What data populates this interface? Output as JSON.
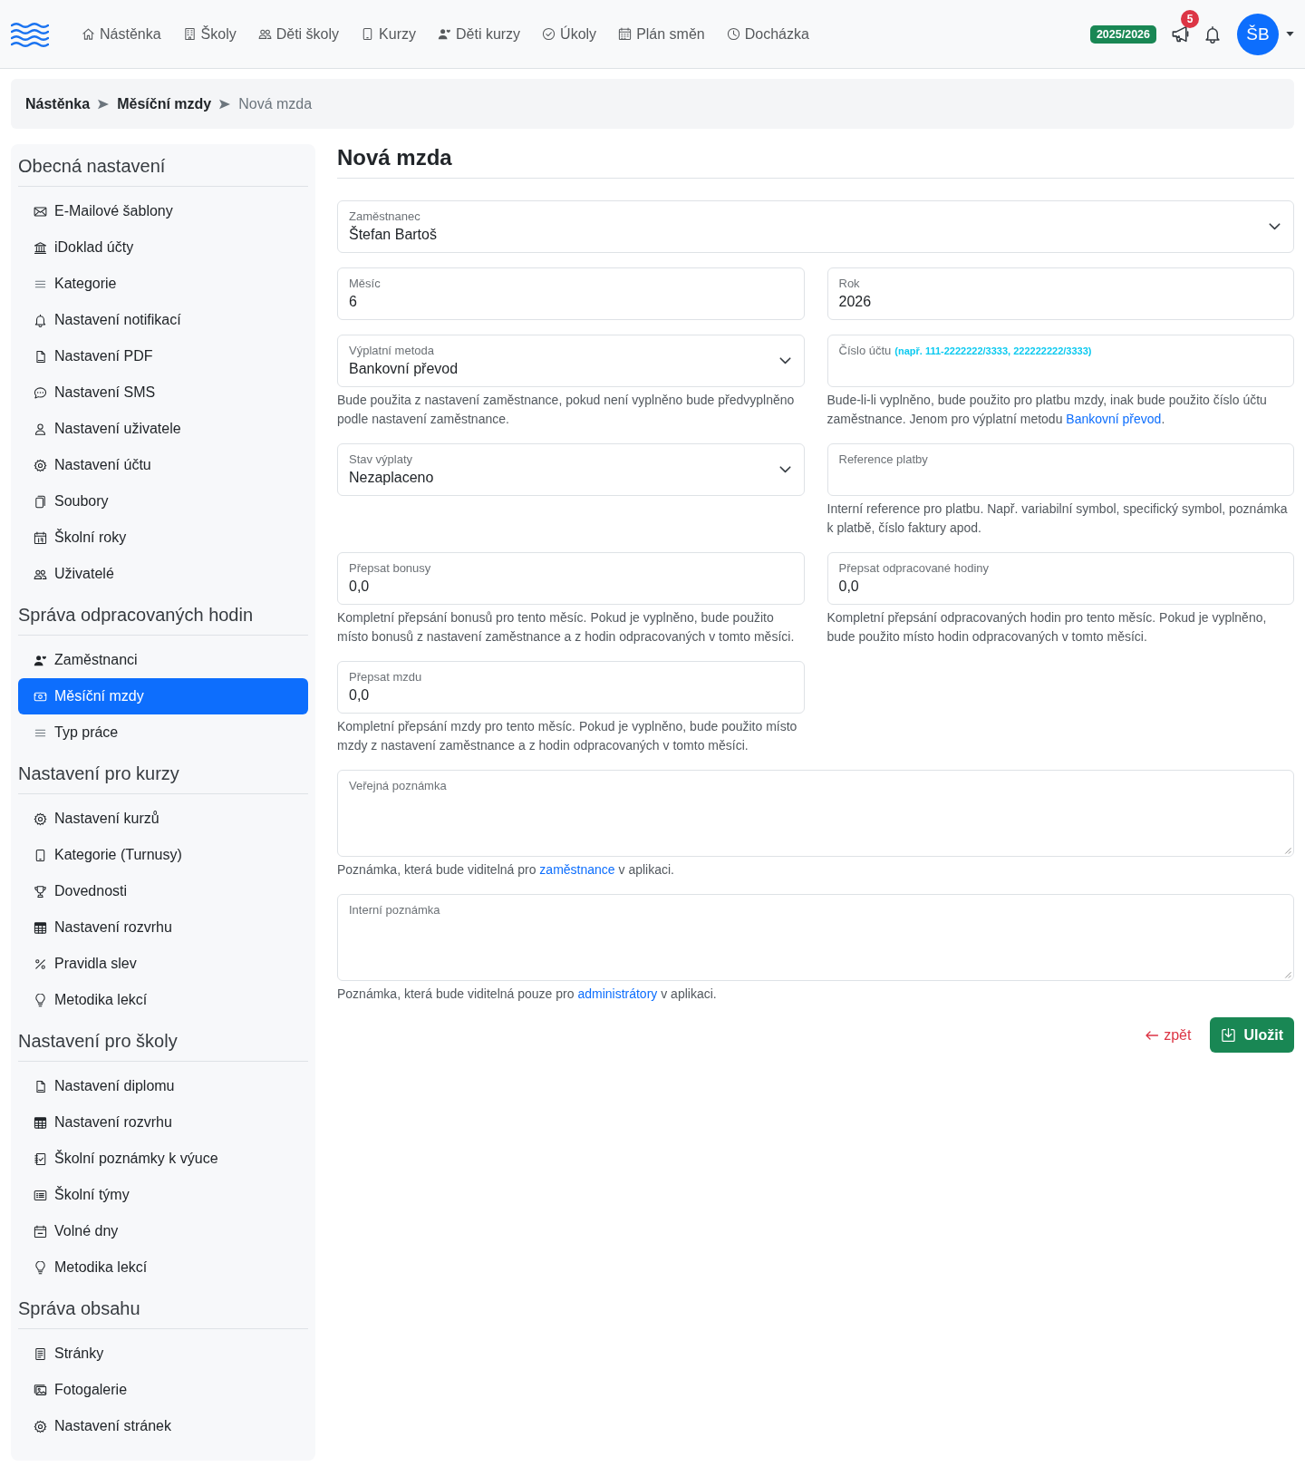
{
  "navbar": {
    "items": [
      "Nástěnka",
      "Školy",
      "Děti školy",
      "Kurzy",
      "Děti kurzy",
      "Úkoly",
      "Plán směn",
      "Docházka"
    ],
    "school_year": "2025/2026",
    "notifications": {
      "count": "5"
    },
    "user": {
      "initials": "ŠB"
    }
  },
  "breadcrumb": [
    {
      "label": "Nástěnka",
      "current": false
    },
    {
      "label": "Měsíční mzdy",
      "current": false
    },
    {
      "label": "Nová mzda",
      "current": true
    }
  ],
  "sidebar": {
    "sections": [
      {
        "title": "Obecná nastavení",
        "items": [
          {
            "label": "E-Mailové šablony",
            "selected": false
          },
          {
            "label": "iDoklad účty",
            "selected": false
          },
          {
            "label": "Kategorie",
            "selected": false
          },
          {
            "label": "Nastavení notifikací",
            "selected": false
          },
          {
            "label": "Nastavení PDF",
            "selected": false
          },
          {
            "label": "Nastavení SMS",
            "selected": false
          },
          {
            "label": "Nastavení uživatele",
            "selected": false
          },
          {
            "label": "Nastavení účtu",
            "selected": false
          },
          {
            "label": "Soubory",
            "selected": false
          },
          {
            "label": "Školní roky",
            "selected": false
          },
          {
            "label": "Uživatelé",
            "selected": false
          }
        ]
      },
      {
        "title": "Správa odpracovaných hodin",
        "items": [
          {
            "label": "Zaměstnanci",
            "selected": false
          },
          {
            "label": "Měsíční mzdy",
            "selected": true
          },
          {
            "label": "Typ práce",
            "selected": false
          }
        ]
      },
      {
        "title": "Nastavení pro kurzy",
        "items": [
          {
            "label": "Nastavení kurzů",
            "selected": false
          },
          {
            "label": "Kategorie (Turnusy)",
            "selected": false
          },
          {
            "label": "Dovednosti",
            "selected": false
          },
          {
            "label": "Nastavení rozvrhu",
            "selected": false
          },
          {
            "label": "Pravidla slev",
            "selected": false
          },
          {
            "label": "Metodika lekcí",
            "selected": false
          }
        ]
      },
      {
        "title": "Nastavení pro školy",
        "items": [
          {
            "label": "Nastavení diplomu",
            "selected": false
          },
          {
            "label": "Nastavení rozvrhu",
            "selected": false
          },
          {
            "label": "Školní poznámky k výuce",
            "selected": false
          },
          {
            "label": "Školní týmy",
            "selected": false
          },
          {
            "label": "Volné dny",
            "selected": false
          },
          {
            "label": "Metodika lekcí",
            "selected": false
          }
        ]
      },
      {
        "title": "Správa obsahu",
        "items": [
          {
            "label": "Stránky",
            "selected": false
          },
          {
            "label": "Fotogalerie",
            "selected": false
          },
          {
            "label": "Nastavení stránek",
            "selected": false
          }
        ]
      }
    ]
  },
  "form": {
    "title": "Nová mzda",
    "employee": {
      "kind": "select",
      "label": "Zaměstnanec",
      "value": "Štefan Bartoš"
    },
    "fields": [
      {
        "kind": "input",
        "label": "Měsíc",
        "value": "6"
      },
      {
        "kind": "input",
        "label": "Rok",
        "value": "2026"
      },
      {
        "kind": "select",
        "label": "Výplatní metoda",
        "value": "Bankovní převod",
        "help": [
          {
            "kind": "text",
            "text": "Bude použita z nastavení zaměstnance, pokud není vyplněno bude předvyplněno podle nastavení zaměstnance."
          }
        ]
      },
      {
        "kind": "input",
        "label": "Číslo účtu",
        "hint": "(např. 111-2222222/3333, 222222222/3333)",
        "help": [
          {
            "kind": "text",
            "text": "Bude-li-li vyplněno, bude použito pro platbu mzdy, inak bude použito číslo účtu zaměstnance. Jenom pro výplatní metodu "
          },
          {
            "kind": "link",
            "text": "Bankovní převod"
          },
          {
            "kind": "text",
            "text": "."
          }
        ]
      },
      {
        "kind": "select",
        "label": "Stav výplaty",
        "value": "Nezaplaceno"
      },
      {
        "kind": "input",
        "label": "Reference platby",
        "help": [
          {
            "kind": "text",
            "text": "Interní reference pro platbu. Např. variabilní symbol, specifický symbol, poznámka k platbě, číslo faktury apod."
          }
        ]
      },
      {
        "kind": "input",
        "label": "Přepsat bonusy",
        "value": "0,0",
        "help": [
          {
            "kind": "text",
            "text": "Kompletní přepsání bonusů pro tento měsíc. Pokud je vyplněno, bude použito místo bonusů z nastavení zaměstnance a z hodin odpracovaných v tomto měsíci."
          }
        ]
      },
      {
        "kind": "input",
        "label": "Přepsat odpracované hodiny",
        "value": "0,0",
        "help": [
          {
            "kind": "text",
            "text": "Kompletní přepsání odpracovaných hodin pro tento měsíc. Pokud je vyplněno, bude použito místo hodin odpracovaných v tomto měsíci."
          }
        ]
      },
      {
        "kind": "input",
        "label": "Přepsat mzdu",
        "value": "0,0",
        "help": [
          {
            "kind": "text",
            "text": "Kompletní přepsání mzdy pro tento měsíc. Pokud je vyplněno, bude použito místo mzdy z nastavení zaměstnance a z hodin odpracovaných v tomto měsíci."
          }
        ]
      }
    ],
    "notes": [
      {
        "kind": "textarea",
        "label": "Veřejná poznámka",
        "help": [
          {
            "kind": "text",
            "text": "Poznámka, která bude viditelná pro "
          },
          {
            "kind": "link",
            "text": "zaměstnance"
          },
          {
            "kind": "text",
            "text": " v aplikaci."
          }
        ]
      },
      {
        "kind": "textarea",
        "label": "Interní poznámka",
        "help": [
          {
            "kind": "text",
            "text": "Poznámka, která bude viditelná pouze pro "
          },
          {
            "kind": "link",
            "text": "administrátory"
          },
          {
            "kind": "text",
            "text": " v aplikaci."
          }
        ]
      }
    ],
    "actions": {
      "back": "zpět",
      "save": "Uložit"
    }
  }
}
